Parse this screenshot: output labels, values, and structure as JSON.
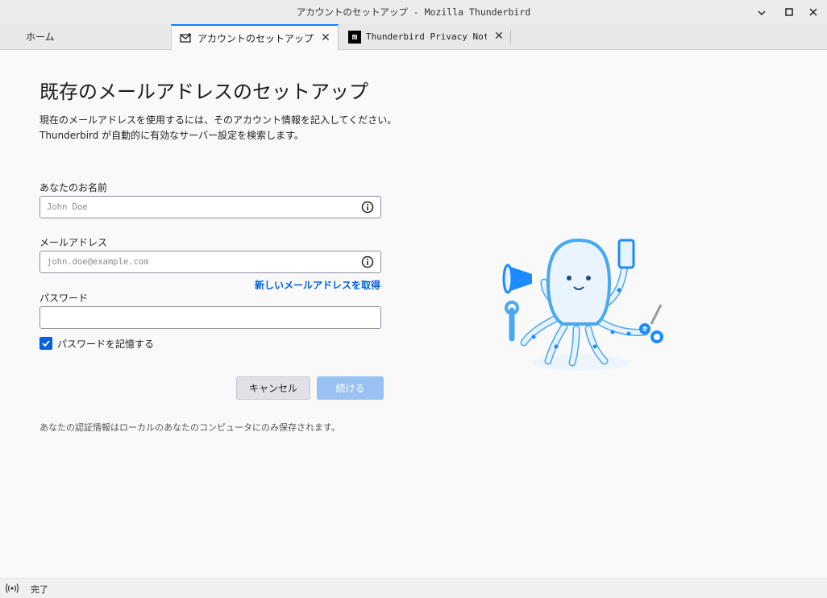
{
  "window": {
    "title": "アカウントのセットアップ - Mozilla Thunderbird",
    "minimize_icon": "minimize-icon",
    "maximize_icon": "maximize-icon",
    "close_icon": "close-icon"
  },
  "tabs": [
    {
      "label": "ホーム",
      "active": false
    },
    {
      "label": "アカウントのセットアップ",
      "icon": "mail-setup-icon",
      "active": true
    },
    {
      "label": "Thunderbird Privacy Notice",
      "icon": "mozilla-m-icon",
      "active": false
    }
  ],
  "setup": {
    "heading": "既存のメールアドレスのセットアップ",
    "desc_line1": "現在のメールアドレスを使用するには、そのアカウント情報を記入してください。",
    "desc_line2": "Thunderbird が自動的に有効なサーバー設定を検索します。",
    "name_label": "あなたのお名前",
    "name_placeholder": "John Doe",
    "name_value": "",
    "email_label": "メールアドレス",
    "email_placeholder": "john.doe@example.com",
    "email_value": "",
    "new_email_link": "新しいメールアドレスを取得",
    "password_label": "パスワード",
    "password_value": "",
    "remember_password_label": "パスワードを記憶する",
    "remember_password_checked": true,
    "cancel_label": "キャンセル",
    "continue_label": "続ける",
    "local_storage_note": "あなたの認証情報はローカルのあなたのコンピュータにのみ保存されます。"
  },
  "status": {
    "icon": "connection-icon",
    "text": "完了"
  },
  "colors": {
    "accent": "#0060df",
    "continue_disabled": "#99c2f2",
    "mascot_blue": "#1a8cff"
  }
}
